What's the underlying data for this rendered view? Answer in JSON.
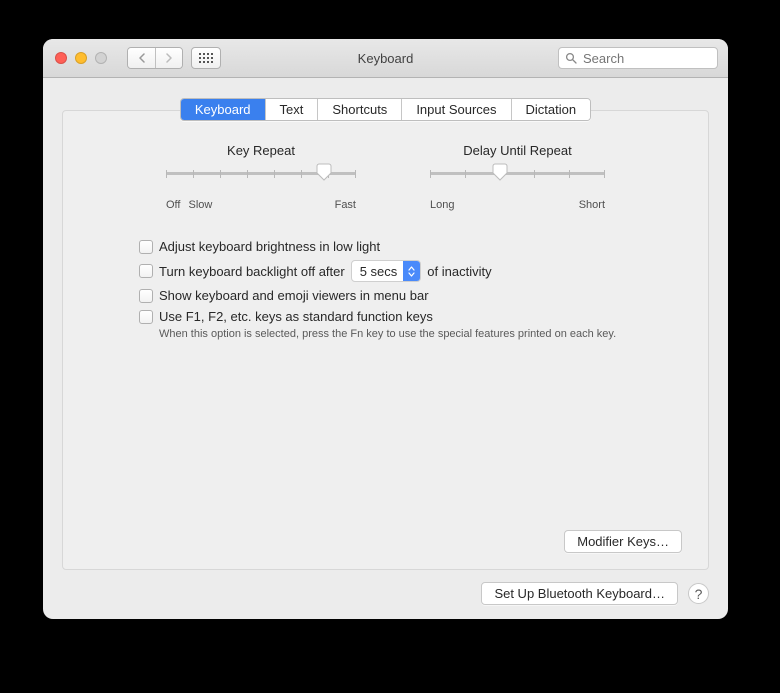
{
  "window": {
    "title": "Keyboard"
  },
  "search": {
    "placeholder": "Search"
  },
  "tabs": [
    {
      "label": "Keyboard",
      "active": true
    },
    {
      "label": "Text",
      "active": false
    },
    {
      "label": "Shortcuts",
      "active": false
    },
    {
      "label": "Input Sources",
      "active": false
    },
    {
      "label": "Dictation",
      "active": false
    }
  ],
  "sliders": {
    "key_repeat": {
      "title": "Key Repeat",
      "min_label_left": "Off",
      "min_label_left2": "Slow",
      "max_label": "Fast",
      "ticks": 8,
      "value_pct": 83
    },
    "delay_until_repeat": {
      "title": "Delay Until Repeat",
      "min_label": "Long",
      "max_label": "Short",
      "ticks": 6,
      "value_pct": 40
    }
  },
  "checks": {
    "brightness": {
      "label": "Adjust keyboard brightness in low light",
      "checked": false
    },
    "backlight_off": {
      "label_before": "Turn keyboard backlight off after",
      "label_after": "of inactivity",
      "select_value": "5 secs",
      "checked": false
    },
    "emoji": {
      "label": "Show keyboard and emoji viewers in menu bar",
      "checked": false
    },
    "fnkeys": {
      "label": "Use F1, F2, etc. keys as standard function keys",
      "help": "When this option is selected, press the Fn key to use the special features printed on each key.",
      "checked": false
    }
  },
  "buttons": {
    "modifier_keys": "Modifier Keys…",
    "bluetooth": "Set Up Bluetooth Keyboard…",
    "help": "?"
  }
}
